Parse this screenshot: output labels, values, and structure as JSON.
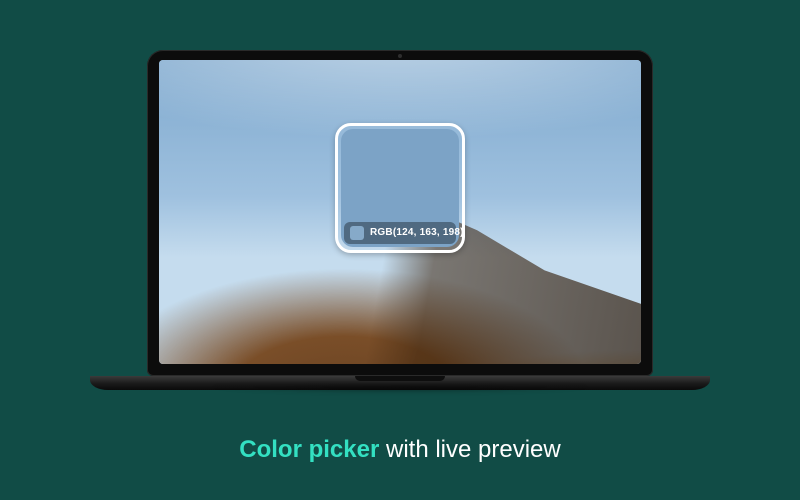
{
  "picker": {
    "sample_color": "#7ca3c6",
    "swatch_color": "#86aac9",
    "value_label": "RGB(124, 163, 198)"
  },
  "caption": {
    "accent": "Color picker",
    "rest": " with live preview"
  }
}
